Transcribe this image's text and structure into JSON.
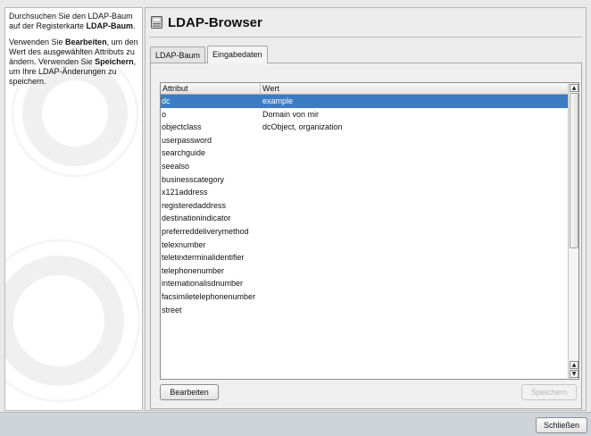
{
  "help": {
    "p1_pre": "Durchsuchen Sie den LDAP-Baum auf der Registerkarte ",
    "p1_bold": "LDAP-Baum",
    "p1_post": ".",
    "p2_pre": "Verwenden Sie ",
    "p2_bold1": "Bearbeiten",
    "p2_mid": ", um den Wert des ausgewählten Attributs zu ändern. Verwenden Sie ",
    "p2_bold2": "Speichern",
    "p2_post": ", um Ihre LDAP-Änderungen zu speichern."
  },
  "header": {
    "title": "LDAP-Browser",
    "icon": "ldap-browser-icon"
  },
  "tabs": [
    {
      "label": "LDAP-Baum",
      "active": false
    },
    {
      "label": "Eingabedaten",
      "active": true
    }
  ],
  "table": {
    "columns": [
      "Attribut",
      "Wert"
    ],
    "rows": [
      {
        "attr": "dc",
        "value": "example",
        "selected": true
      },
      {
        "attr": "o",
        "value": "Domain von mir",
        "selected": false
      },
      {
        "attr": "objectclass",
        "value": "dcObject, organization",
        "selected": false
      },
      {
        "attr": "userpassword",
        "value": "",
        "selected": false
      },
      {
        "attr": "searchguide",
        "value": "",
        "selected": false
      },
      {
        "attr": "seealso",
        "value": "",
        "selected": false
      },
      {
        "attr": "businesscategory",
        "value": "",
        "selected": false
      },
      {
        "attr": "x121address",
        "value": "",
        "selected": false
      },
      {
        "attr": "registeredaddress",
        "value": "",
        "selected": false
      },
      {
        "attr": "destinationindicator",
        "value": "",
        "selected": false
      },
      {
        "attr": "preferreddeliverymethod",
        "value": "",
        "selected": false
      },
      {
        "attr": "telexnumber",
        "value": "",
        "selected": false
      },
      {
        "attr": "teletexterminalidentifier",
        "value": "",
        "selected": false
      },
      {
        "attr": "telephonenumber",
        "value": "",
        "selected": false
      },
      {
        "attr": "internationalisdnumber",
        "value": "",
        "selected": false
      },
      {
        "attr": "facsimiletelephonenumber",
        "value": "",
        "selected": false
      },
      {
        "attr": "street",
        "value": "",
        "selected": false
      }
    ]
  },
  "buttons": {
    "edit": "Bearbeiten",
    "save": "Speichern",
    "close": "Schließen"
  },
  "colors": {
    "selection": "#3b7cc5",
    "bottom_bar": "#cfd4da"
  }
}
